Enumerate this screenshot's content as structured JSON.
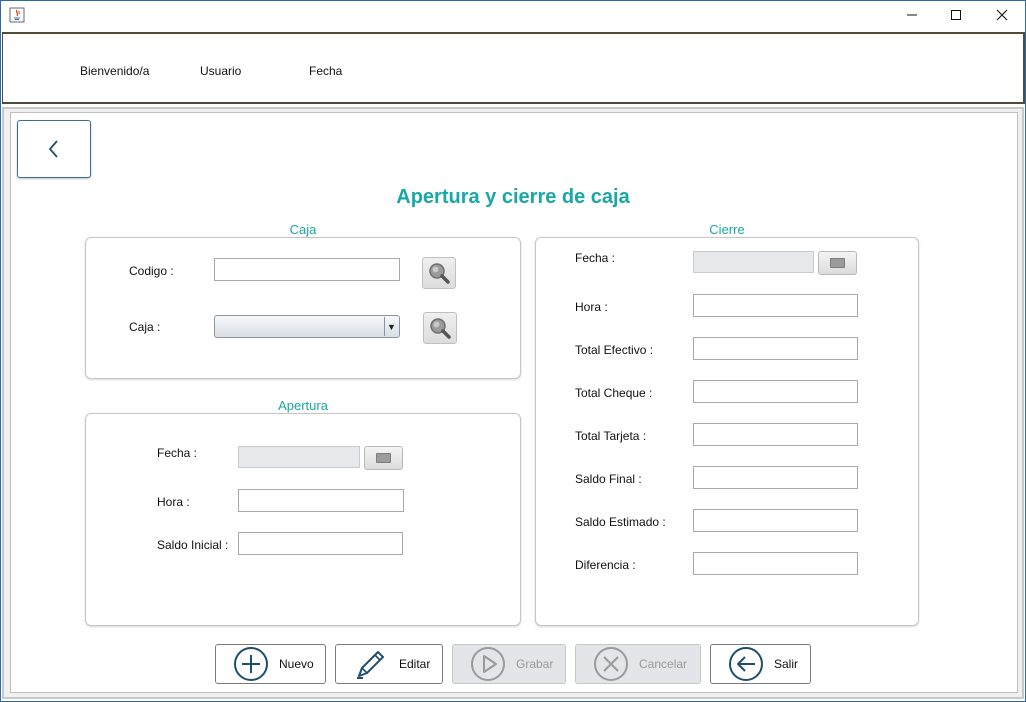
{
  "window": {
    "buttons": {
      "minimize": "—",
      "maximize": "☐",
      "close": "✕"
    }
  },
  "header": {
    "welcome": "Bienvenido/a",
    "user": "Usuario",
    "date": "Fecha"
  },
  "page_title": "Apertura y cierre de caja",
  "caja": {
    "title": "Caja",
    "codigo_label": "Codigo :",
    "codigo_value": "",
    "caja_label": "Caja :",
    "caja_selected": ""
  },
  "apertura": {
    "title": "Apertura",
    "fecha_label": "Fecha :",
    "hora_label": "Hora :",
    "saldo_inicial_label": "Saldo Inicial :"
  },
  "cierre": {
    "title": "Cierre",
    "fecha_label": "Fecha :",
    "hora_label": "Hora :",
    "total_efectivo_label": "Total Efectivo :",
    "total_cheque_label": "Total Cheque :",
    "total_tarjeta_label": "Total Tarjeta :",
    "saldo_final_label": "Saldo Final :",
    "saldo_estimado_label": "Saldo Estimado :",
    "diferencia_label": "Diferencia :"
  },
  "actions": {
    "nuevo": "Nuevo",
    "editar": "Editar",
    "grabar": "Grabar",
    "cancelar": "Cancelar",
    "salir": "Salir"
  },
  "colors": {
    "accent": "#1aa7a7",
    "icon_dark": "#1f4e6b",
    "disabled": "#9a9a9a"
  }
}
